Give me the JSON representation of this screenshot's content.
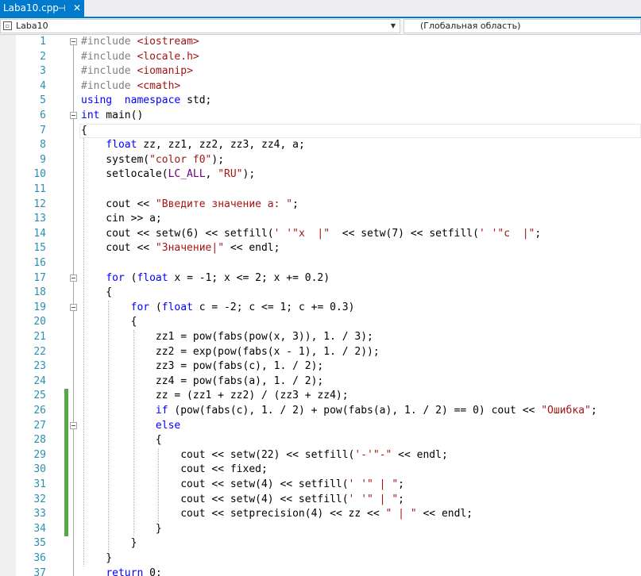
{
  "tab": {
    "title": "Laba10.cpp",
    "pin_glyph": "⊣",
    "close_glyph": "✕"
  },
  "nav": {
    "project": "Laba10",
    "scope": "(Глобальная область)"
  },
  "lines": [
    {
      "n": "1",
      "fold": true,
      "chg": false,
      "tokens": [
        [
          "pp",
          "#include "
        ],
        [
          "str",
          "<iostream>"
        ]
      ]
    },
    {
      "n": "2",
      "fold": false,
      "chg": false,
      "tokens": [
        [
          "pp",
          "#include "
        ],
        [
          "str",
          "<locale.h>"
        ]
      ]
    },
    {
      "n": "3",
      "fold": false,
      "chg": false,
      "tokens": [
        [
          "pp",
          "#include "
        ],
        [
          "str",
          "<iomanip>"
        ]
      ]
    },
    {
      "n": "4",
      "fold": false,
      "chg": false,
      "tokens": [
        [
          "pp",
          "#include "
        ],
        [
          "str",
          "<cmath>"
        ]
      ]
    },
    {
      "n": "5",
      "fold": false,
      "chg": false,
      "tokens": [
        [
          "kw",
          "using"
        ],
        [
          "",
          "  "
        ],
        [
          "kw",
          "namespace"
        ],
        [
          "",
          " std;"
        ]
      ]
    },
    {
      "n": "6",
      "fold": true,
      "chg": false,
      "tokens": [
        [
          "kw",
          "int"
        ],
        [
          "",
          " main()"
        ]
      ]
    },
    {
      "n": "7",
      "fold": false,
      "chg": false,
      "tokens": [
        [
          "",
          "{"
        ]
      ]
    },
    {
      "n": "8",
      "fold": false,
      "chg": false,
      "tokens": [
        [
          "",
          "    "
        ],
        [
          "kw",
          "float"
        ],
        [
          "",
          " zz, zz1, zz2, zz3, zz4, a;"
        ]
      ]
    },
    {
      "n": "9",
      "fold": false,
      "chg": false,
      "tokens": [
        [
          "",
          "    system("
        ],
        [
          "str",
          "\"color f0\""
        ],
        [
          "",
          ");"
        ]
      ]
    },
    {
      "n": "10",
      "fold": false,
      "chg": false,
      "tokens": [
        [
          "",
          "    setlocale("
        ],
        [
          "mac",
          "LC_ALL"
        ],
        [
          "",
          ", "
        ],
        [
          "str",
          "\"RU\""
        ],
        [
          "",
          ");"
        ]
      ]
    },
    {
      "n": "11",
      "fold": false,
      "chg": false,
      "tokens": []
    },
    {
      "n": "12",
      "fold": false,
      "chg": false,
      "tokens": [
        [
          "",
          "    cout << "
        ],
        [
          "str",
          "\"Введите значение a: \""
        ],
        [
          "",
          ";"
        ]
      ]
    },
    {
      "n": "13",
      "fold": false,
      "chg": false,
      "tokens": [
        [
          "",
          "    cin >> a;"
        ]
      ]
    },
    {
      "n": "14",
      "fold": false,
      "chg": false,
      "tokens": [
        [
          "",
          "    cout << setw(6) << setfill("
        ],
        [
          "str",
          "' '"
        ],
        [
          ") << "
        ],
        [
          "str",
          "\"x  |\""
        ],
        [
          "",
          "  << setw(7) << setfill("
        ],
        [
          "str",
          "' '"
        ],
        [
          ") << "
        ],
        [
          "str",
          "\"c  |\""
        ],
        [
          "",
          ";"
        ]
      ]
    },
    {
      "n": "15",
      "fold": false,
      "chg": false,
      "tokens": [
        [
          "",
          "    cout << "
        ],
        [
          "str",
          "\"Значение|\""
        ],
        [
          "",
          " << endl;"
        ]
      ]
    },
    {
      "n": "16",
      "fold": false,
      "chg": false,
      "tokens": []
    },
    {
      "n": "17",
      "fold": true,
      "chg": false,
      "tokens": [
        [
          "",
          "    "
        ],
        [
          "kw",
          "for"
        ],
        [
          "",
          " ("
        ],
        [
          "kw",
          "float"
        ],
        [
          "",
          " x = -1; x <= 2; x += 0.2)"
        ]
      ]
    },
    {
      "n": "18",
      "fold": false,
      "chg": false,
      "tokens": [
        [
          "",
          "    {"
        ]
      ]
    },
    {
      "n": "19",
      "fold": true,
      "chg": false,
      "tokens": [
        [
          "",
          "        "
        ],
        [
          "kw",
          "for"
        ],
        [
          "",
          " ("
        ],
        [
          "kw",
          "float"
        ],
        [
          "",
          " c = -2; c <= 1; c += 0.3)"
        ]
      ]
    },
    {
      "n": "20",
      "fold": false,
      "chg": false,
      "tokens": [
        [
          "",
          "        {"
        ]
      ]
    },
    {
      "n": "21",
      "fold": false,
      "chg": false,
      "tokens": [
        [
          "",
          "            zz1 = pow(fabs(pow(x, 3)), 1. / 3);"
        ]
      ]
    },
    {
      "n": "22",
      "fold": false,
      "chg": false,
      "tokens": [
        [
          "",
          "            zz2 = exp(pow(fabs(x - 1), 1. / 2));"
        ]
      ]
    },
    {
      "n": "23",
      "fold": false,
      "chg": false,
      "tokens": [
        [
          "",
          "            zz3 = pow(fabs(c), 1. / 2);"
        ]
      ]
    },
    {
      "n": "24",
      "fold": false,
      "chg": false,
      "tokens": [
        [
          "",
          "            zz4 = pow(fabs(a), 1. / 2);"
        ]
      ]
    },
    {
      "n": "25",
      "fold": false,
      "chg": true,
      "tokens": [
        [
          "",
          "            zz = (zz1 + zz2) / (zz3 + zz4);"
        ]
      ]
    },
    {
      "n": "26",
      "fold": false,
      "chg": true,
      "tokens": [
        [
          "",
          "            "
        ],
        [
          "kw",
          "if"
        ],
        [
          "",
          " (pow(fabs(c), 1. / 2) + pow(fabs(a), 1. / 2) == 0) cout << "
        ],
        [
          "str",
          "\"Ошибка\""
        ],
        [
          "",
          ";"
        ]
      ]
    },
    {
      "n": "27",
      "fold": true,
      "chg": true,
      "tokens": [
        [
          "",
          "            "
        ],
        [
          "kw",
          "else"
        ]
      ]
    },
    {
      "n": "28",
      "fold": false,
      "chg": true,
      "tokens": [
        [
          "",
          "            {"
        ]
      ]
    },
    {
      "n": "29",
      "fold": false,
      "chg": true,
      "tokens": [
        [
          "",
          "                cout << setw(22) << setfill("
        ],
        [
          "str",
          "'-'"
        ],
        [
          ") << "
        ],
        [
          "str",
          "\"-\""
        ],
        [
          "",
          " << endl;"
        ]
      ]
    },
    {
      "n": "30",
      "fold": false,
      "chg": true,
      "tokens": [
        [
          "",
          "                cout << fixed;"
        ]
      ]
    },
    {
      "n": "31",
      "fold": false,
      "chg": true,
      "tokens": [
        [
          "",
          "                cout << setw(4) << setfill("
        ],
        [
          "str",
          "' '"
        ],
        [
          ") << right << setprecision(1) << x << "
        ],
        [
          "str",
          "\" | \""
        ],
        [
          "",
          ";"
        ]
      ]
    },
    {
      "n": "32",
      "fold": false,
      "chg": true,
      "tokens": [
        [
          "",
          "                cout << setw(4) << setfill("
        ],
        [
          "str",
          "' '"
        ],
        [
          ") << right << setprecision(1) << c << "
        ],
        [
          "str",
          "\" | \""
        ],
        [
          "",
          ";"
        ]
      ]
    },
    {
      "n": "33",
      "fold": false,
      "chg": true,
      "tokens": [
        [
          "",
          "                cout << setprecision(4) << zz << "
        ],
        [
          "str",
          "\" | \""
        ],
        [
          "",
          " << endl;"
        ]
      ]
    },
    {
      "n": "34",
      "fold": false,
      "chg": true,
      "tokens": [
        [
          "",
          "            }"
        ]
      ]
    },
    {
      "n": "35",
      "fold": false,
      "chg": false,
      "tokens": [
        [
          "",
          "        }"
        ]
      ]
    },
    {
      "n": "36",
      "fold": false,
      "chg": false,
      "tokens": [
        [
          "",
          "    }"
        ]
      ]
    },
    {
      "n": "37",
      "fold": false,
      "chg": false,
      "tokens": [
        [
          "",
          "    "
        ],
        [
          "kw",
          "return"
        ],
        [
          "",
          " 0;"
        ]
      ]
    }
  ]
}
